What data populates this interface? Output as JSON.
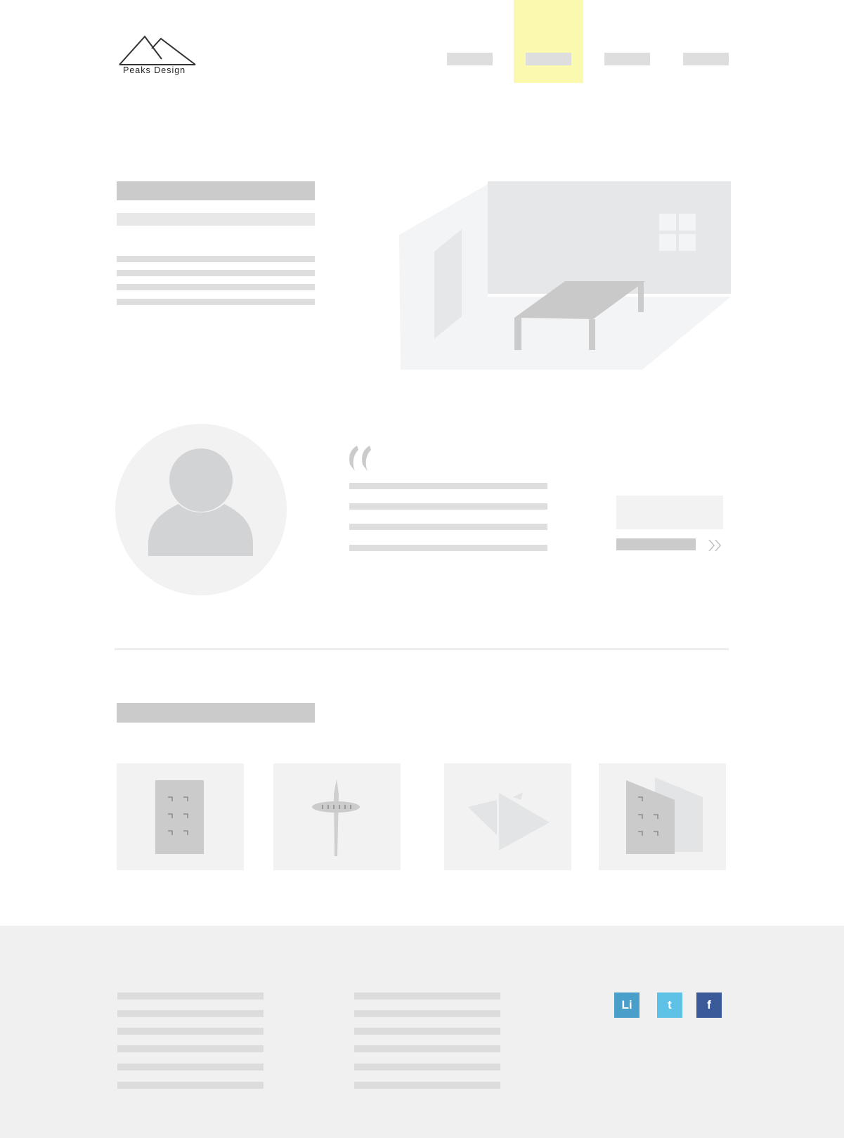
{
  "brand": {
    "name": "Peaks Design"
  },
  "header": {
    "nav_items": [
      {
        "icon": "placeholder-bar",
        "active": false
      },
      {
        "icon": "placeholder-bar",
        "active": true
      },
      {
        "icon": "placeholder-bar",
        "active": false
      },
      {
        "icon": "placeholder-bar",
        "active": false
      }
    ],
    "active_color": "#fbf8b0"
  },
  "hero": {
    "illustration": "isometric-room-with-table-illustration"
  },
  "testimonial": {
    "avatar": "user-avatar-icon",
    "quote_mark": "“"
  },
  "gallery": {
    "items": [
      {
        "icon": "office-building-icon"
      },
      {
        "icon": "space-needle-icon"
      },
      {
        "icon": "paper-boat-icon"
      },
      {
        "icon": "buildings-icon"
      }
    ]
  },
  "footer": {
    "social": [
      {
        "label": "Li",
        "icon": "linkedin-icon",
        "color": "#4a9fca"
      },
      {
        "label": "t",
        "icon": "twitter-icon",
        "color": "#5ec2e6"
      },
      {
        "label": "f",
        "icon": "facebook-icon",
        "color": "#3b5a9a"
      }
    ]
  }
}
